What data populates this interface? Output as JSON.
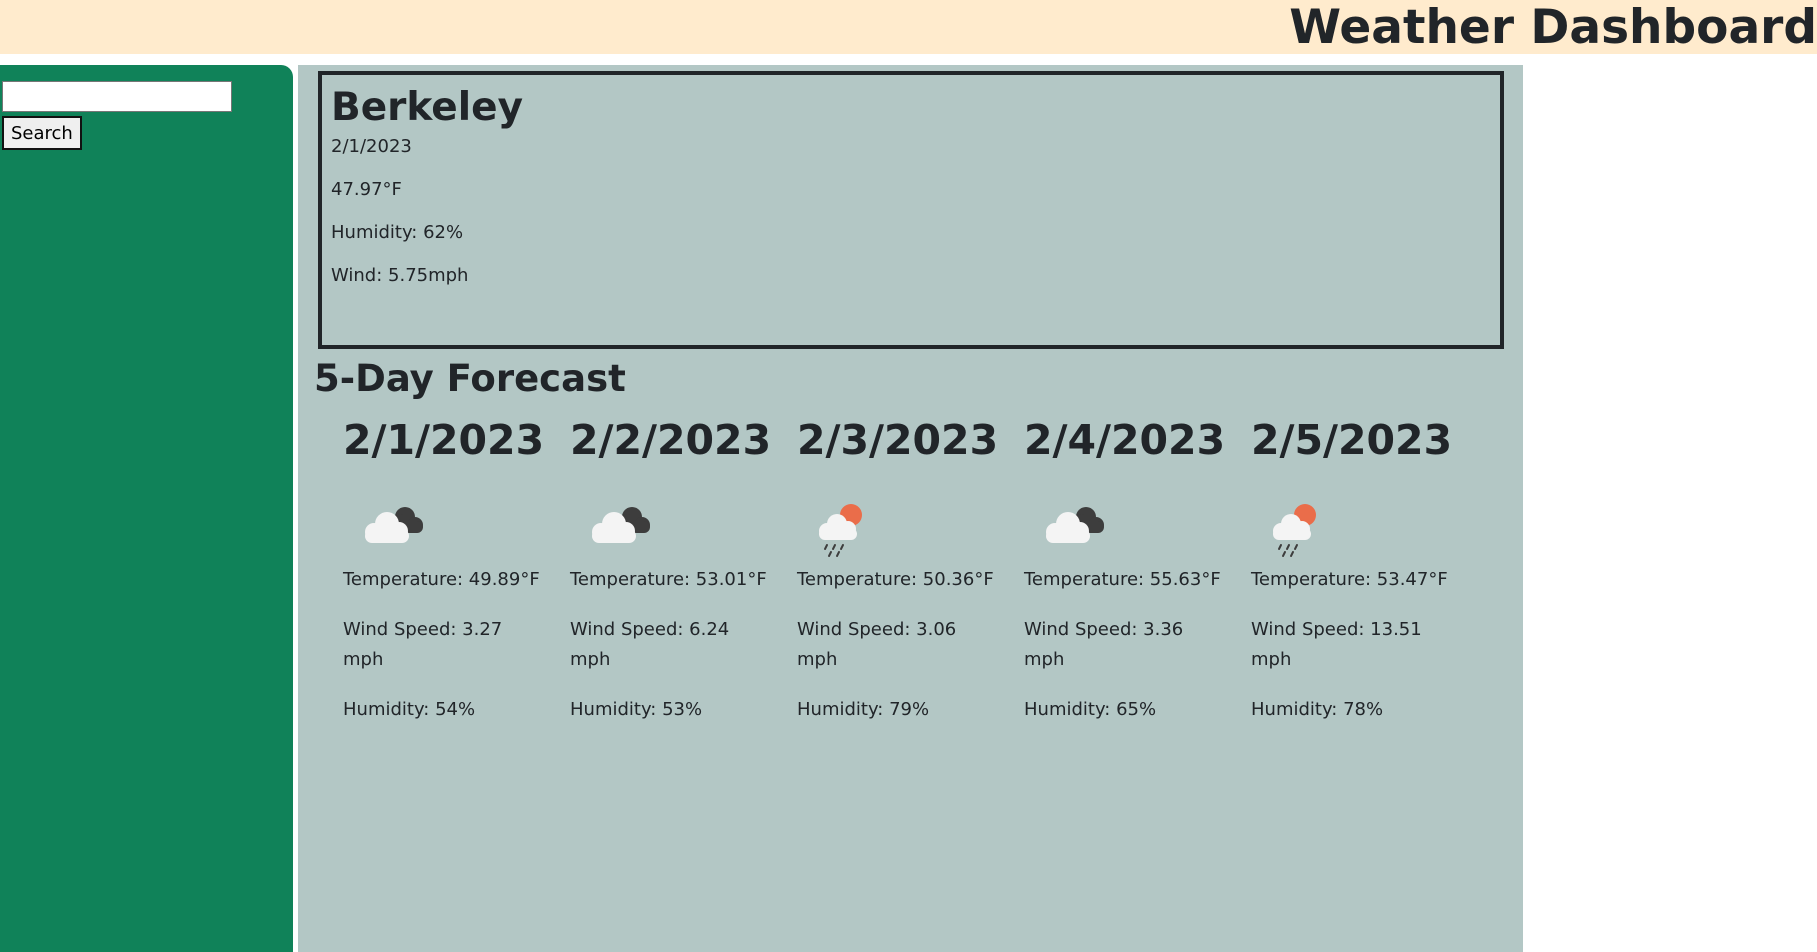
{
  "header": {
    "title": "Weather Dashboard"
  },
  "search": {
    "value": "",
    "placeholder": "",
    "button_label": "Search"
  },
  "current": {
    "city": "Berkeley",
    "date": "2/1/2023",
    "temperature": "47.97°F",
    "humidity": "Humidity: 62%",
    "wind": "Wind: 5.75mph"
  },
  "forecast": {
    "title": "5-Day Forecast",
    "days": [
      {
        "date": "2/1/2023",
        "icon": "cloudy-icon",
        "temperature": "Temperature: 49.89°F",
        "wind": "Wind Speed: 3.27 mph",
        "humidity": "Humidity: 54%"
      },
      {
        "date": "2/2/2023",
        "icon": "cloudy-icon",
        "temperature": "Temperature: 53.01°F",
        "wind": "Wind Speed: 6.24 mph",
        "humidity": "Humidity: 53%"
      },
      {
        "date": "2/3/2023",
        "icon": "rain-sun-icon",
        "temperature": "Temperature: 50.36°F",
        "wind": "Wind Speed: 3.06 mph",
        "humidity": "Humidity: 79%"
      },
      {
        "date": "2/4/2023",
        "icon": "cloudy-icon",
        "temperature": "Temperature: 55.63°F",
        "wind": "Wind Speed: 3.36 mph",
        "humidity": "Humidity: 65%"
      },
      {
        "date": "2/5/2023",
        "icon": "rain-sun-icon",
        "temperature": "Temperature: 53.47°F",
        "wind": "Wind Speed: 13.51 mph",
        "humidity": "Humidity: 78%"
      }
    ]
  },
  "colors": {
    "header_bg": "#ffebcd",
    "sidebar_bg": "#108259",
    "main_bg": "#b3c7c5",
    "text": "#212529"
  }
}
